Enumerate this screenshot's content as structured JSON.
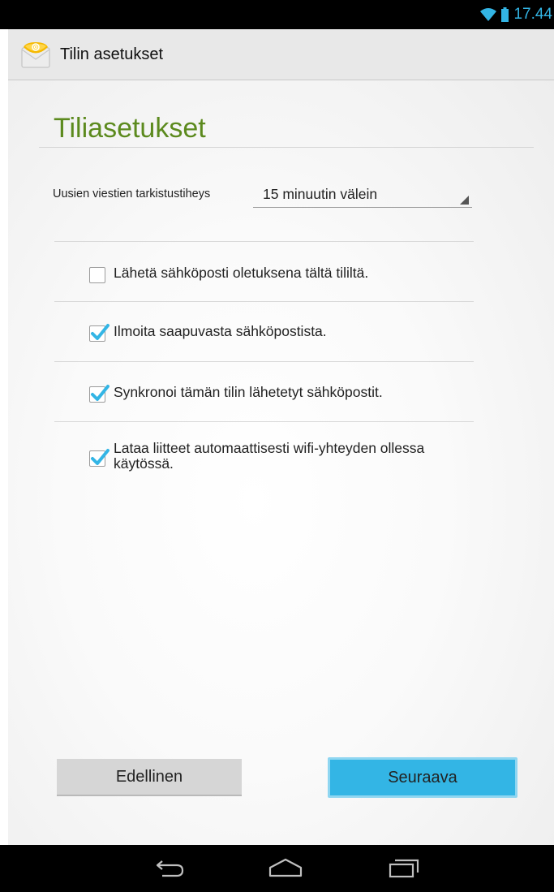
{
  "status_bar": {
    "time": "17.44",
    "icons": [
      "wifi-icon",
      "battery-icon"
    ]
  },
  "action_bar": {
    "icon": "email-app-icon",
    "title": "Tilin asetukset"
  },
  "section": {
    "title": "Tiliasetukset"
  },
  "check_frequency": {
    "label": "Uusien viestien tarkistustiheys",
    "value": "15 minuutin välein"
  },
  "options": [
    {
      "label": "Lähetä sähköposti oletuksena tältä tililtä.",
      "checked": false
    },
    {
      "label": "Ilmoita saapuvasta sähköpostista.",
      "checked": true
    },
    {
      "label": "Synkronoi tämän tilin lähetetyt sähköpostit.",
      "checked": true
    },
    {
      "label": "Lataa liitteet automaattisesti wifi-yhteyden ollessa käytössä.",
      "checked": true
    }
  ],
  "buttons": {
    "previous": "Edellinen",
    "next": "Seuraava"
  },
  "nav_bar": {
    "icons": [
      "back-icon",
      "home-icon",
      "recent-apps-icon"
    ]
  },
  "colors": {
    "accent": "#33b5e5",
    "section_title": "#5c8a1e",
    "check": "#33b5e5"
  }
}
